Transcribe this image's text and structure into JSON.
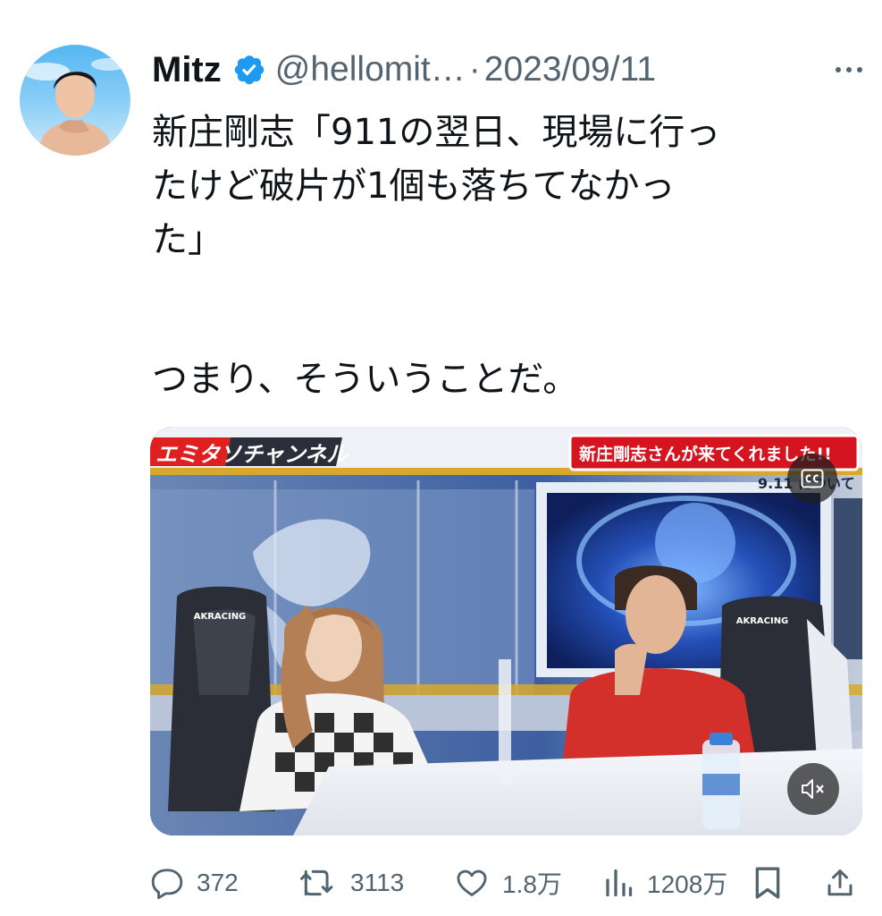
{
  "tweet": {
    "author_name": "Mitz",
    "handle": "@hellomit…",
    "separator": "·",
    "date": "2023/09/11",
    "text_lines": [
      "新庄剛志「911の翌日、現場に行っ",
      "たけど破片が1個も落ちてなかっ",
      "た」"
    ],
    "text_second": "つまり、そういうことだ。"
  },
  "media": {
    "overlay_channel": "エミタソチャンネル",
    "overlay_headline": "新庄剛志さんが来てくれました!!",
    "overlay_subtitle": "9.11 について",
    "chair_brand": "AKRACING"
  },
  "actions": {
    "replies": "372",
    "reposts": "3113",
    "likes": "1.8万",
    "views": "1208万"
  },
  "colors": {
    "verified": "#1d9bf0",
    "secondary_text": "#536471",
    "headline_red": "#d4141f"
  }
}
